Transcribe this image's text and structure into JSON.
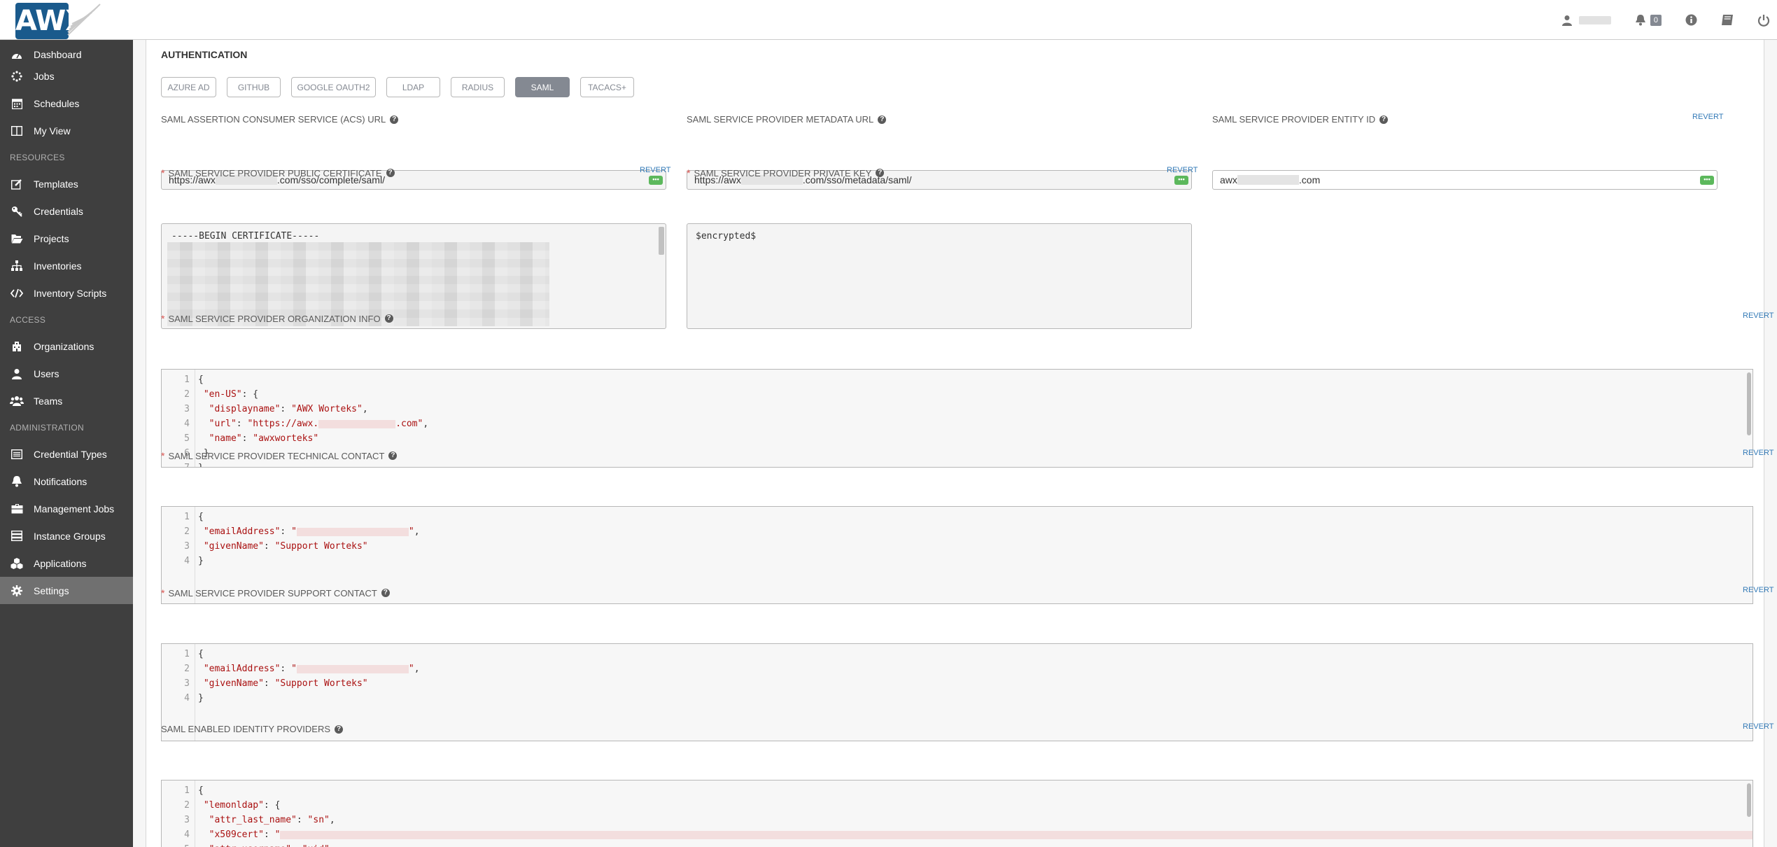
{
  "app": {
    "logo_text": "AWX"
  },
  "header": {
    "notifications_count": "0"
  },
  "sidebar": {
    "items_top": [
      {
        "label": "Dashboard",
        "icon": "dashboard-icon"
      },
      {
        "label": "Jobs",
        "icon": "jobs-icon"
      },
      {
        "label": "Schedules",
        "icon": "calendar-icon"
      },
      {
        "label": "My View",
        "icon": "view-icon"
      }
    ],
    "section_resources": "RESOURCES",
    "items_resources": [
      {
        "label": "Templates",
        "icon": "pencil-icon"
      },
      {
        "label": "Credentials",
        "icon": "key-icon"
      },
      {
        "label": "Projects",
        "icon": "folder-icon"
      },
      {
        "label": "Inventories",
        "icon": "sitemap-icon"
      },
      {
        "label": "Inventory Scripts",
        "icon": "code-icon"
      }
    ],
    "section_access": "ACCESS",
    "items_access": [
      {
        "label": "Organizations",
        "icon": "building-icon"
      },
      {
        "label": "Users",
        "icon": "user-icon"
      },
      {
        "label": "Teams",
        "icon": "users-icon"
      }
    ],
    "section_admin": "ADMINISTRATION",
    "items_admin": [
      {
        "label": "Credential Types",
        "icon": "list-icon"
      },
      {
        "label": "Notifications",
        "icon": "bell-icon"
      },
      {
        "label": "Management Jobs",
        "icon": "briefcase-icon"
      },
      {
        "label": "Instance Groups",
        "icon": "server-icon"
      },
      {
        "label": "Applications",
        "icon": "cubes-icon"
      },
      {
        "label": "Settings",
        "icon": "gear-icon"
      }
    ]
  },
  "main": {
    "title": "AUTHENTICATION",
    "tabs": [
      "AZURE AD",
      "GITHUB",
      "GOOGLE OAUTH2",
      "LDAP",
      "RADIUS",
      "SAML",
      "TACACS+"
    ],
    "active_tab": "SAML",
    "revert": "REVERT",
    "acs_url": {
      "label": "SAML ASSERTION CONSUMER SERVICE (ACS) URL",
      "value_prefix": "https://awx",
      "value_suffix": ".com/sso/complete/saml/"
    },
    "metadata_url": {
      "label": "SAML SERVICE PROVIDER METADATA URL",
      "value_prefix": "https://awx",
      "value_suffix": ".com/sso/metadata/saml/"
    },
    "entity_id": {
      "label": "SAML SERVICE PROVIDER ENTITY ID",
      "value_prefix": "awx",
      "value_suffix": ".com"
    },
    "public_cert": {
      "label": "SAML SERVICE PROVIDER PUBLIC CERTIFICATE",
      "value": "-----BEGIN CERTIFICATE-----"
    },
    "private_key": {
      "label": "SAML SERVICE PROVIDER PRIVATE KEY",
      "value": "$encrypted$"
    },
    "org_info": {
      "label": "SAML SERVICE PROVIDER ORGANIZATION INFO"
    },
    "tech_contact": {
      "label": "SAML SERVICE PROVIDER TECHNICAL CONTACT"
    },
    "support_contact": {
      "label": "SAML SERVICE PROVIDER SUPPORT CONTACT"
    },
    "idp": {
      "label": "SAML ENABLED IDENTITY PROVIDERS"
    }
  }
}
